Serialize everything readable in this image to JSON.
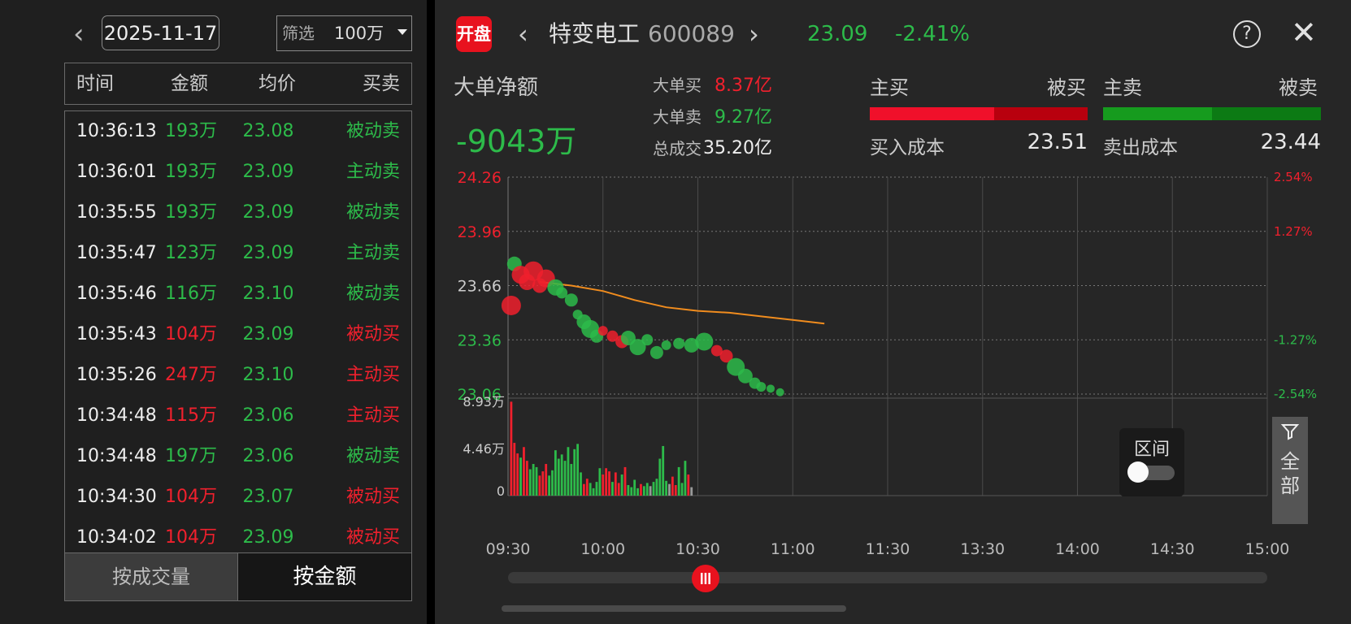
{
  "left_panel": {
    "date": "2025-11-17",
    "filter_label": "筛选",
    "filter_value": "100万",
    "columns": [
      "时间",
      "金额",
      "均价",
      "买卖"
    ],
    "rows": [
      {
        "time": "10:36:13",
        "amount": "193万",
        "avg": "23.08",
        "side": "被动卖",
        "color": "green"
      },
      {
        "time": "10:36:01",
        "amount": "193万",
        "avg": "23.09",
        "side": "主动卖",
        "color": "green"
      },
      {
        "time": "10:35:55",
        "amount": "193万",
        "avg": "23.09",
        "side": "被动卖",
        "color": "green"
      },
      {
        "time": "10:35:47",
        "amount": "123万",
        "avg": "23.09",
        "side": "主动卖",
        "color": "green"
      },
      {
        "time": "10:35:46",
        "amount": "116万",
        "avg": "23.10",
        "side": "被动卖",
        "color": "green"
      },
      {
        "time": "10:35:43",
        "amount": "104万",
        "avg": "23.09",
        "side": "被动买",
        "color": "red"
      },
      {
        "time": "10:35:26",
        "amount": "247万",
        "avg": "23.10",
        "side": "主动买",
        "color": "red"
      },
      {
        "time": "10:34:48",
        "amount": "115万",
        "avg": "23.06",
        "side": "主动买",
        "color": "red"
      },
      {
        "time": "10:34:48",
        "amount": "197万",
        "avg": "23.06",
        "side": "被动卖",
        "color": "green"
      },
      {
        "time": "10:34:30",
        "amount": "104万",
        "avg": "23.07",
        "side": "被动买",
        "color": "red"
      },
      {
        "time": "10:34:02",
        "amount": "104万",
        "avg": "23.09",
        "side": "被动买",
        "color": "red"
      }
    ],
    "btn_volume": "按成交量",
    "btn_amount": "按金额"
  },
  "header": {
    "open_badge": "开盘",
    "stock_name": "特变电工",
    "stock_code": "600089",
    "price": "23.09",
    "change_pct": "-2.41%"
  },
  "summary": {
    "net_label": "大单净额",
    "net_value": "-9043万",
    "big_buy_label": "大单买",
    "big_buy_value": "8.37亿",
    "big_sell_label": "大单卖",
    "big_sell_value": "9.27亿",
    "total_label": "总成交",
    "total_value": "35.20亿",
    "active_buy": "主买",
    "passive_buy": "被买",
    "active_sell": "主卖",
    "passive_sell": "被卖",
    "buy_cost_label": "买入成本",
    "buy_cost_value": "23.51",
    "sell_cost_label": "卖出成本",
    "sell_cost_value": "23.44",
    "buy_active_share": 0.57,
    "sell_active_share": 0.5
  },
  "colors": {
    "up": "#f0202d",
    "down": "#2dbb4a",
    "avg_line": "#f08c1e",
    "accent": "#e8121e"
  },
  "chart_data": {
    "type": "scatter",
    "y_labels": [
      "24.26",
      "23.96",
      "23.66",
      "23.36",
      "23.06"
    ],
    "y_range": [
      23.06,
      24.26
    ],
    "pct_labels": [
      "2.54%",
      "1.27%",
      "",
      "-1.27%",
      "-2.54%"
    ],
    "x_labels": [
      "09:30",
      "10:00",
      "10:30",
      "11:00",
      "11:30",
      "13:30",
      "14:00",
      "14:30",
      "15:00"
    ],
    "vol_labels": [
      "8.93万",
      "4.46万",
      "0"
    ],
    "vol_max": 8.93,
    "avg_line": [
      [
        0,
        23.68
      ],
      [
        10,
        23.66
      ],
      [
        20,
        23.63
      ],
      [
        30,
        23.58
      ],
      [
        40,
        23.54
      ],
      [
        50,
        23.52
      ],
      [
        60,
        23.51
      ],
      [
        70,
        23.49
      ],
      [
        80,
        23.47
      ],
      [
        90,
        23.45
      ]
    ],
    "bubbles": [
      {
        "t": 1,
        "p": 23.55,
        "s": 12,
        "c": "red"
      },
      {
        "t": 2,
        "p": 23.78,
        "s": 9,
        "c": "green"
      },
      {
        "t": 4,
        "p": 23.72,
        "s": 11,
        "c": "red"
      },
      {
        "t": 6,
        "p": 23.68,
        "s": 10,
        "c": "red"
      },
      {
        "t": 8,
        "p": 23.74,
        "s": 12,
        "c": "red"
      },
      {
        "t": 10,
        "p": 23.66,
        "s": 9,
        "c": "red"
      },
      {
        "t": 12,
        "p": 23.7,
        "s": 11,
        "c": "red"
      },
      {
        "t": 15,
        "p": 23.65,
        "s": 10,
        "c": "green"
      },
      {
        "t": 17,
        "p": 23.62,
        "s": 7,
        "c": "green"
      },
      {
        "t": 20,
        "p": 23.58,
        "s": 8,
        "c": "green"
      },
      {
        "t": 22,
        "p": 23.5,
        "s": 6,
        "c": "green"
      },
      {
        "t": 24,
        "p": 23.46,
        "s": 9,
        "c": "green"
      },
      {
        "t": 26,
        "p": 23.42,
        "s": 11,
        "c": "green"
      },
      {
        "t": 28,
        "p": 23.38,
        "s": 8,
        "c": "green"
      },
      {
        "t": 30,
        "p": 23.41,
        "s": 6,
        "c": "red"
      },
      {
        "t": 33,
        "p": 23.38,
        "s": 7,
        "c": "red"
      },
      {
        "t": 36,
        "p": 23.35,
        "s": 8,
        "c": "red"
      },
      {
        "t": 38,
        "p": 23.37,
        "s": 9,
        "c": "green"
      },
      {
        "t": 41,
        "p": 23.32,
        "s": 10,
        "c": "green"
      },
      {
        "t": 44,
        "p": 23.36,
        "s": 7,
        "c": "green"
      },
      {
        "t": 47,
        "p": 23.29,
        "s": 8,
        "c": "green"
      },
      {
        "t": 50,
        "p": 23.33,
        "s": 6,
        "c": "green"
      },
      {
        "t": 54,
        "p": 23.34,
        "s": 7,
        "c": "green"
      },
      {
        "t": 58,
        "p": 23.33,
        "s": 9,
        "c": "green"
      },
      {
        "t": 62,
        "p": 23.35,
        "s": 11,
        "c": "green"
      },
      {
        "t": 66,
        "p": 23.3,
        "s": 7,
        "c": "red"
      },
      {
        "t": 69,
        "p": 23.27,
        "s": 8,
        "c": "red"
      },
      {
        "t": 72,
        "p": 23.21,
        "s": 11,
        "c": "green"
      },
      {
        "t": 75,
        "p": 23.16,
        "s": 9,
        "c": "green"
      },
      {
        "t": 78,
        "p": 23.12,
        "s": 7,
        "c": "green"
      },
      {
        "t": 80,
        "p": 23.1,
        "s": 6,
        "c": "green"
      },
      {
        "t": 83,
        "p": 23.09,
        "s": 5,
        "c": "green"
      },
      {
        "t": 86,
        "p": 23.07,
        "s": 5,
        "c": "green"
      }
    ],
    "volume_bars": [
      {
        "t": 1,
        "v": 8.9,
        "c": "red"
      },
      {
        "t": 2,
        "v": 5.0,
        "c": "red"
      },
      {
        "t": 3,
        "v": 4.0,
        "c": "red"
      },
      {
        "t": 4,
        "v": 3.6,
        "c": "green"
      },
      {
        "t": 5,
        "v": 4.6,
        "c": "red"
      },
      {
        "t": 6,
        "v": 3.3,
        "c": "red"
      },
      {
        "t": 7,
        "v": 2.5,
        "c": "green"
      },
      {
        "t": 8,
        "v": 3.0,
        "c": "green"
      },
      {
        "t": 9,
        "v": 2.7,
        "c": "green"
      },
      {
        "t": 10,
        "v": 1.9,
        "c": "red"
      },
      {
        "t": 11,
        "v": 2.3,
        "c": "red"
      },
      {
        "t": 12,
        "v": 3.0,
        "c": "red"
      },
      {
        "t": 13,
        "v": 1.9,
        "c": "green"
      },
      {
        "t": 14,
        "v": 2.4,
        "c": "green"
      },
      {
        "t": 15,
        "v": 4.3,
        "c": "green"
      },
      {
        "t": 16,
        "v": 3.5,
        "c": "green"
      },
      {
        "t": 17,
        "v": 3.9,
        "c": "green"
      },
      {
        "t": 18,
        "v": 3.3,
        "c": "green"
      },
      {
        "t": 19,
        "v": 4.6,
        "c": "green"
      },
      {
        "t": 20,
        "v": 3.0,
        "c": "green"
      },
      {
        "t": 21,
        "v": 4.4,
        "c": "green"
      },
      {
        "t": 22,
        "v": 4.9,
        "c": "green"
      },
      {
        "t": 23,
        "v": 2.2,
        "c": "green"
      },
      {
        "t": 24,
        "v": 1.1,
        "c": "red"
      },
      {
        "t": 25,
        "v": 1.6,
        "c": "red"
      },
      {
        "t": 26,
        "v": 1.2,
        "c": "green"
      },
      {
        "t": 27,
        "v": 0.7,
        "c": "green"
      },
      {
        "t": 28,
        "v": 1.3,
        "c": "green"
      },
      {
        "t": 29,
        "v": 2.6,
        "c": "green"
      },
      {
        "t": 30,
        "v": 2.0,
        "c": "red"
      },
      {
        "t": 31,
        "v": 2.6,
        "c": "red"
      },
      {
        "t": 32,
        "v": 2.3,
        "c": "red"
      },
      {
        "t": 33,
        "v": 1.3,
        "c": "green"
      },
      {
        "t": 34,
        "v": 2.2,
        "c": "red"
      },
      {
        "t": 35,
        "v": 1.2,
        "c": "red"
      },
      {
        "t": 36,
        "v": 2.0,
        "c": "green"
      },
      {
        "t": 37,
        "v": 2.7,
        "c": "red"
      },
      {
        "t": 38,
        "v": 1.0,
        "c": "green"
      },
      {
        "t": 39,
        "v": 0.8,
        "c": "green"
      },
      {
        "t": 40,
        "v": 1.5,
        "c": "green"
      },
      {
        "t": 41,
        "v": 0.7,
        "c": "green"
      },
      {
        "t": 42,
        "v": 1.1,
        "c": "red"
      },
      {
        "t": 43,
        "v": 0.9,
        "c": "green"
      },
      {
        "t": 44,
        "v": 1.2,
        "c": "green"
      },
      {
        "t": 45,
        "v": 0.9,
        "c": "grey"
      },
      {
        "t": 46,
        "v": 1.3,
        "c": "green"
      },
      {
        "t": 47,
        "v": 1.6,
        "c": "green"
      },
      {
        "t": 48,
        "v": 3.5,
        "c": "green"
      },
      {
        "t": 49,
        "v": 4.7,
        "c": "green"
      },
      {
        "t": 50,
        "v": 1.4,
        "c": "green"
      },
      {
        "t": 51,
        "v": 1.1,
        "c": "grey"
      },
      {
        "t": 52,
        "v": 1.8,
        "c": "red"
      },
      {
        "t": 53,
        "v": 1.0,
        "c": "red"
      },
      {
        "t": 54,
        "v": 2.7,
        "c": "green"
      },
      {
        "t": 55,
        "v": 1.2,
        "c": "green"
      },
      {
        "t": 56,
        "v": 3.3,
        "c": "green"
      },
      {
        "t": 57,
        "v": 2.0,
        "c": "red"
      },
      {
        "t": 58,
        "v": 0.8,
        "c": "grey"
      }
    ]
  },
  "range_toggle_label": "区间",
  "filter_all_label": "全部",
  "slider_position": 0.26
}
